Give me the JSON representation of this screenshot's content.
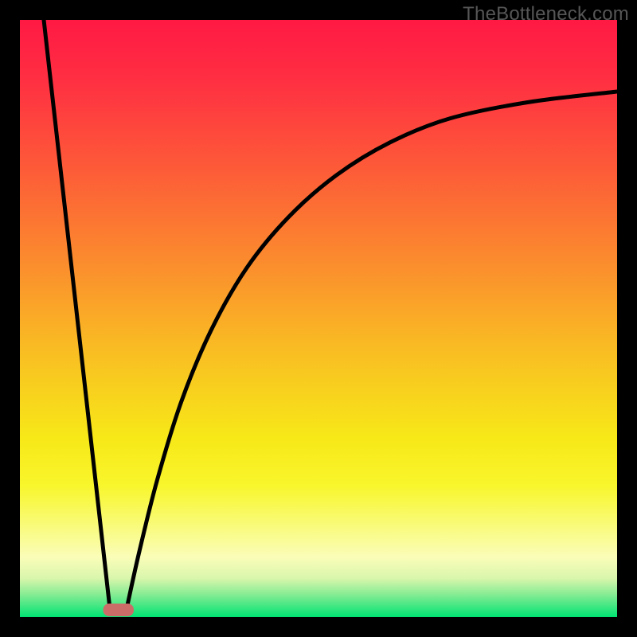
{
  "watermark": "TheBottleneck.com",
  "colors": {
    "frame": "#000000",
    "curve": "#000000",
    "marker_fill": "#CC6C69",
    "marker_stroke": "#CC6C69",
    "gradient_stops": [
      {
        "offset": 0.0,
        "color": "#FF1944"
      },
      {
        "offset": 0.1,
        "color": "#FF2F42"
      },
      {
        "offset": 0.25,
        "color": "#FD5B38"
      },
      {
        "offset": 0.4,
        "color": "#FB8A2E"
      },
      {
        "offset": 0.55,
        "color": "#F9BC23"
      },
      {
        "offset": 0.7,
        "color": "#F7E818"
      },
      {
        "offset": 0.78,
        "color": "#F8F62C"
      },
      {
        "offset": 0.85,
        "color": "#F9FB7E"
      },
      {
        "offset": 0.9,
        "color": "#FAFDB8"
      },
      {
        "offset": 0.935,
        "color": "#D9F6AC"
      },
      {
        "offset": 0.965,
        "color": "#7CEB91"
      },
      {
        "offset": 1.0,
        "color": "#00E373"
      }
    ]
  },
  "chart_data": {
    "type": "line",
    "title": "",
    "xlabel": "",
    "ylabel": "",
    "x_range": [
      0,
      100
    ],
    "y_range": [
      0,
      100
    ],
    "note": "Axes are unlabeled in the image. x and y are normalized 0..100. y=0 is the green band (best), y=100 is top (worst). The curve shape resembles |log(x/x0)| style bottleneck plots: a steep linear descent from x=0 to the minimum, then a concave-rising curve after.",
    "minimum_at_x": 16.5,
    "left_branch_start": {
      "x": 4.0,
      "y": 100.0
    },
    "right_branch_end": {
      "x": 100.0,
      "y": 88.0
    },
    "left_branch": [
      {
        "x": 4.0,
        "y": 100.0
      },
      {
        "x": 15.0,
        "y": 2.0
      }
    ],
    "right_branch": [
      {
        "x": 18.0,
        "y": 2.0
      },
      {
        "x": 20.0,
        "y": 11.0
      },
      {
        "x": 23.0,
        "y": 23.0
      },
      {
        "x": 27.0,
        "y": 36.0
      },
      {
        "x": 32.0,
        "y": 48.0
      },
      {
        "x": 38.0,
        "y": 58.5
      },
      {
        "x": 45.0,
        "y": 67.0
      },
      {
        "x": 53.0,
        "y": 74.0
      },
      {
        "x": 62.0,
        "y": 79.5
      },
      {
        "x": 72.0,
        "y": 83.5
      },
      {
        "x": 85.0,
        "y": 86.2
      },
      {
        "x": 100.0,
        "y": 88.0
      }
    ],
    "marker": {
      "x_center": 16.5,
      "x_halfwidth": 2.5,
      "y": 1.2,
      "height": 2.0
    }
  }
}
